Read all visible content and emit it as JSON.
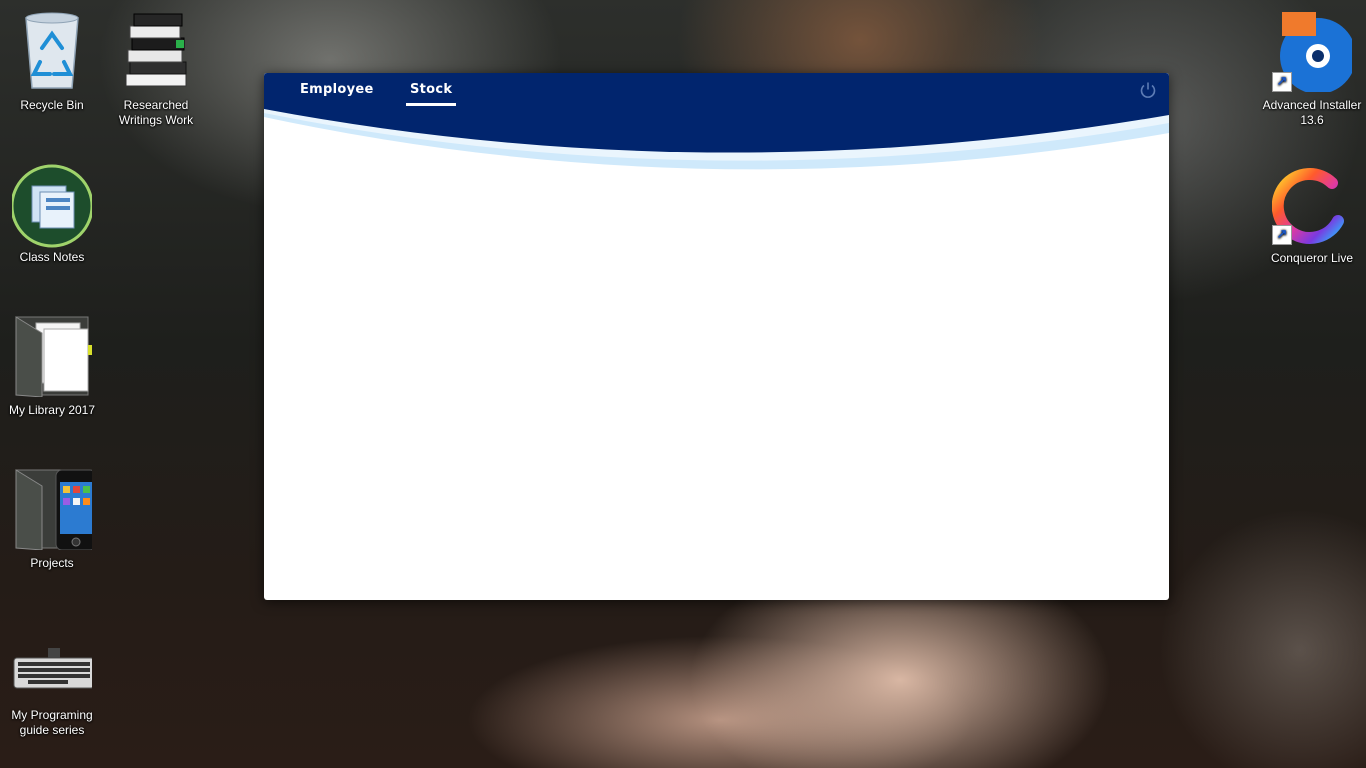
{
  "desktop": {
    "icons_left": [
      {
        "label": "Recycle Bin"
      },
      {
        "label": "Researched Writings Work"
      },
      {
        "label": "Class Notes"
      },
      {
        "label": "My Library 2017"
      },
      {
        "label": "Projects"
      },
      {
        "label": "My Programing guide series"
      }
    ],
    "icons_right": [
      {
        "label": "Advanced Installer 13.6"
      },
      {
        "label": "Conqueror Live"
      }
    ]
  },
  "app": {
    "tabs": [
      {
        "label": "Employee",
        "active": false
      },
      {
        "label": "Stock",
        "active": true
      }
    ],
    "power_icon": "power-icon",
    "colors": {
      "header": "#01256e",
      "wave_light": "#cfe9fb",
      "body": "#ffffff"
    }
  }
}
